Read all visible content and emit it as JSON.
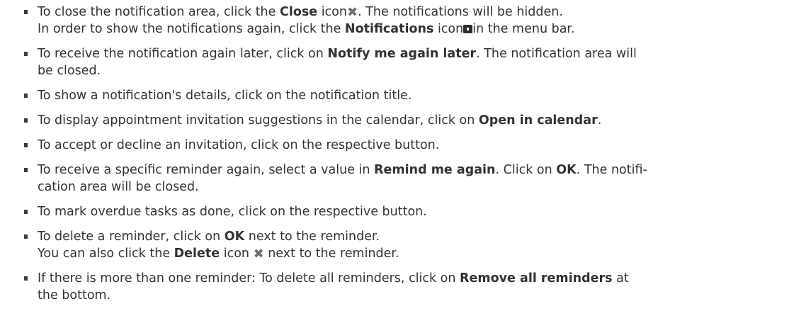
{
  "items": [
    {
      "l1_a": "To close the notification area, click the ",
      "l1_b": "Close",
      "l1_c": " icon",
      "l1_d": ". The notifications will be hidden.",
      "l2_a": "In order to show the notifications again, click the ",
      "l2_b": "Notifications",
      "l2_c": " icon",
      "l2_d": "in the menu bar."
    },
    {
      "l1_a": "To receive the notification again later, click on ",
      "l1_b": "Notify me again later",
      "l1_c": ". The notification area will",
      "l2_a": "be closed."
    },
    {
      "l1_a": "To show a notification's details, click on the notification title."
    },
    {
      "l1_a": "To display appointment invitation suggestions in the calendar, click on ",
      "l1_b": "Open in calendar",
      "l1_c": "."
    },
    {
      "l1_a": "To accept or decline an invitation, click on the respective button."
    },
    {
      "l1_a": "To receive a specific reminder again, select a value in ",
      "l1_b": "Remind me again",
      "l1_c": ". Click on ",
      "l1_d": "OK",
      "l1_e": ". The notifi-",
      "l2_a": "cation area will be closed."
    },
    {
      "l1_a": "To mark overdue tasks as done, click on the respective button."
    },
    {
      "l1_a": "To delete a reminder, click on ",
      "l1_b": "OK",
      "l1_c": " next to the reminder.",
      "l2_a": "You can also click the ",
      "l2_b": "Delete",
      "l2_c": " icon ",
      "l2_d": " next to the reminder."
    },
    {
      "l1_a": "If there is more than one reminder: To delete all reminders, click on ",
      "l1_b": "Remove all reminders",
      "l1_c": " at",
      "l2_a": "the bottom."
    }
  ],
  "icons": {
    "close": "close-icon",
    "notifications": "notifications-icon",
    "delete": "delete-icon"
  }
}
